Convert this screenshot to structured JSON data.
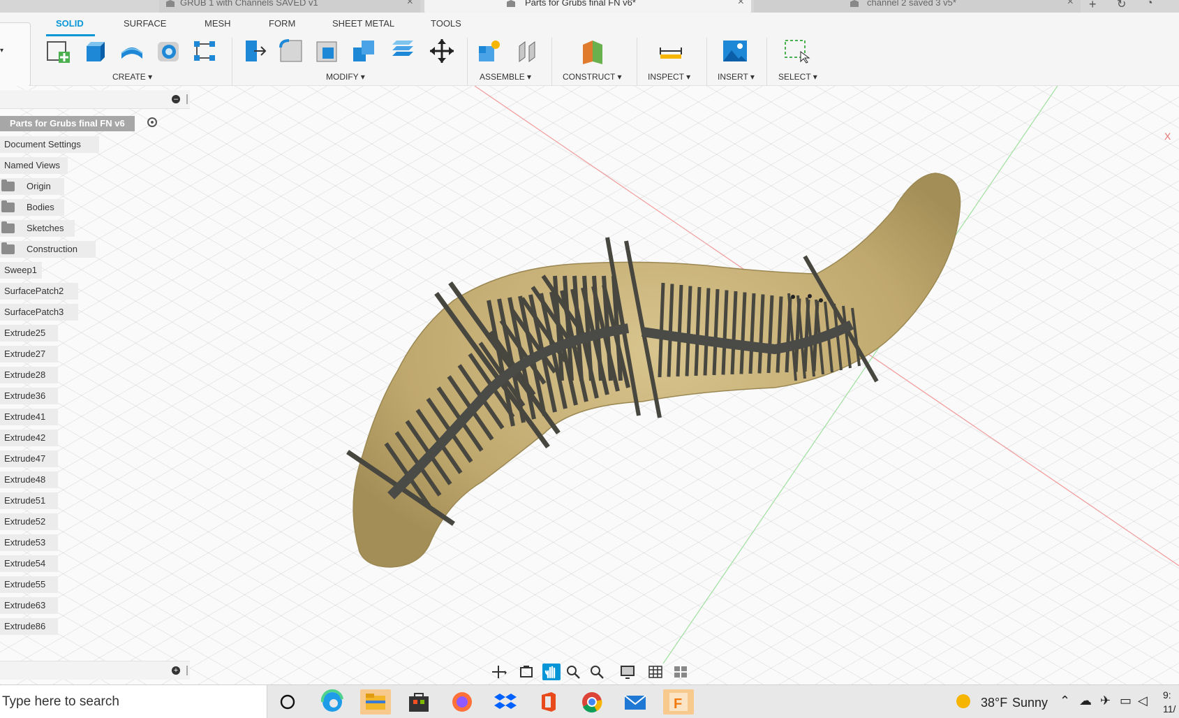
{
  "doc_tabs": [
    {
      "title": "GRUB 1 with Channels SAVED v1",
      "close": "×"
    },
    {
      "title": "Parts for Grubs final FN v6*",
      "close": "×"
    },
    {
      "title": "channel 2 saved 3 v5*",
      "close": "×"
    }
  ],
  "workspace_tabs": [
    "SOLID",
    "SURFACE",
    "MESH",
    "FORM",
    "SHEET METAL",
    "TOOLS"
  ],
  "groups": {
    "create": "CREATE ▾",
    "modify": "MODIFY ▾",
    "assemble": "ASSEMBLE ▾",
    "construct": "CONSTRUCT ▾",
    "inspect": "INSPECT ▾",
    "insert": "INSERT ▾",
    "select": "SELECT ▾"
  },
  "browser": {
    "root": "Parts for Grubs final FN v6",
    "collapse": "–",
    "expand": "+",
    "items": [
      {
        "label": "Document Settings",
        "folder": false
      },
      {
        "label": "Named Views",
        "folder": false
      },
      {
        "label": "Origin",
        "folder": true
      },
      {
        "label": "Bodies",
        "folder": true
      },
      {
        "label": "Sketches",
        "folder": true
      },
      {
        "label": "Construction",
        "folder": true
      },
      {
        "label": "Sweep1",
        "folder": false
      },
      {
        "label": "SurfacePatch2",
        "folder": false
      },
      {
        "label": "SurfacePatch3",
        "folder": false
      },
      {
        "label": "Extrude25",
        "folder": false
      },
      {
        "label": "Extrude27",
        "folder": false
      },
      {
        "label": "Extrude28",
        "folder": false
      },
      {
        "label": "Extrude36",
        "folder": false
      },
      {
        "label": "Extrude41",
        "folder": false
      },
      {
        "label": "Extrude42",
        "folder": false
      },
      {
        "label": "Extrude47",
        "folder": false
      },
      {
        "label": "Extrude48",
        "folder": false
      },
      {
        "label": "Extrude51",
        "folder": false
      },
      {
        "label": "Extrude52",
        "folder": false
      },
      {
        "label": "Extrude53",
        "folder": false
      },
      {
        "label": "Extrude54",
        "folder": false
      },
      {
        "label": "Extrude55",
        "folder": false
      },
      {
        "label": "Extrude63",
        "folder": false
      },
      {
        "label": "Extrude86",
        "folder": false
      }
    ]
  },
  "viewcube_axis": "X",
  "taskbar": {
    "search_placeholder": "Type here to search",
    "weather_temp": "38°F",
    "weather_text": "Sunny",
    "time": "9:",
    "date": "11/"
  },
  "colors": {
    "accent": "#0696d7",
    "grub": "#c9b27a",
    "ribs": "#4a4a46"
  }
}
